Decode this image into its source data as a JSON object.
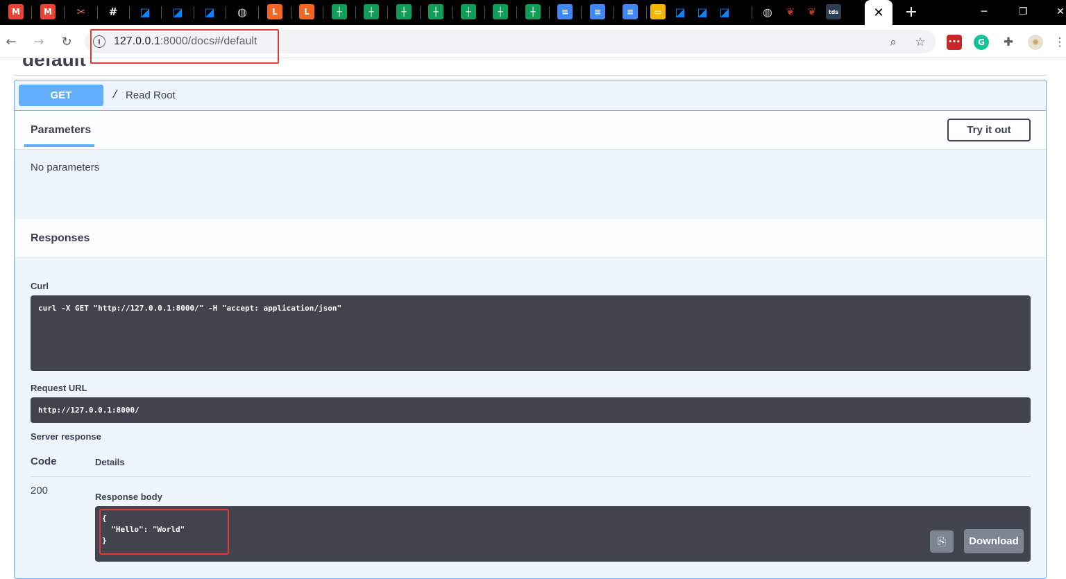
{
  "browser": {
    "active_tab_close": "✕",
    "new_tab": "+",
    "window_controls": {
      "minimize": "─",
      "restore": "❐",
      "close": "✕"
    },
    "url_host": "127.0.0.1",
    "url_rest": ":8000/docs#/default",
    "extension_tds": "tds",
    "extension_grammarly": "G",
    "extension_lastpass": "•••",
    "colors": {
      "accent_highlight": "#e53935",
      "tab_strip": "#000000"
    }
  },
  "page": {
    "section_title": "default",
    "operation": {
      "method": "GET",
      "path": "/",
      "summary": "Read Root"
    },
    "parameters": {
      "tab_label": "Parameters",
      "try_button": "Try it out",
      "empty_text": "No parameters"
    },
    "responses": {
      "title": "Responses",
      "curl_label": "Curl",
      "curl_command": "curl -X GET \"http://127.0.0.1:8000/\" -H \"accept: application/json\"",
      "request_url_label": "Request URL",
      "request_url": "http://127.0.0.1:8000/",
      "server_response_label": "Server response",
      "code_header": "Code",
      "details_header": "Details",
      "status_code": "200",
      "response_body_label": "Response body",
      "response_body": "{\n  \"Hello\": \"World\"\n}",
      "download_button": "Download"
    },
    "colors": {
      "get_method": "#61affe",
      "code_background": "#41444e",
      "text": "#3b4151"
    }
  }
}
